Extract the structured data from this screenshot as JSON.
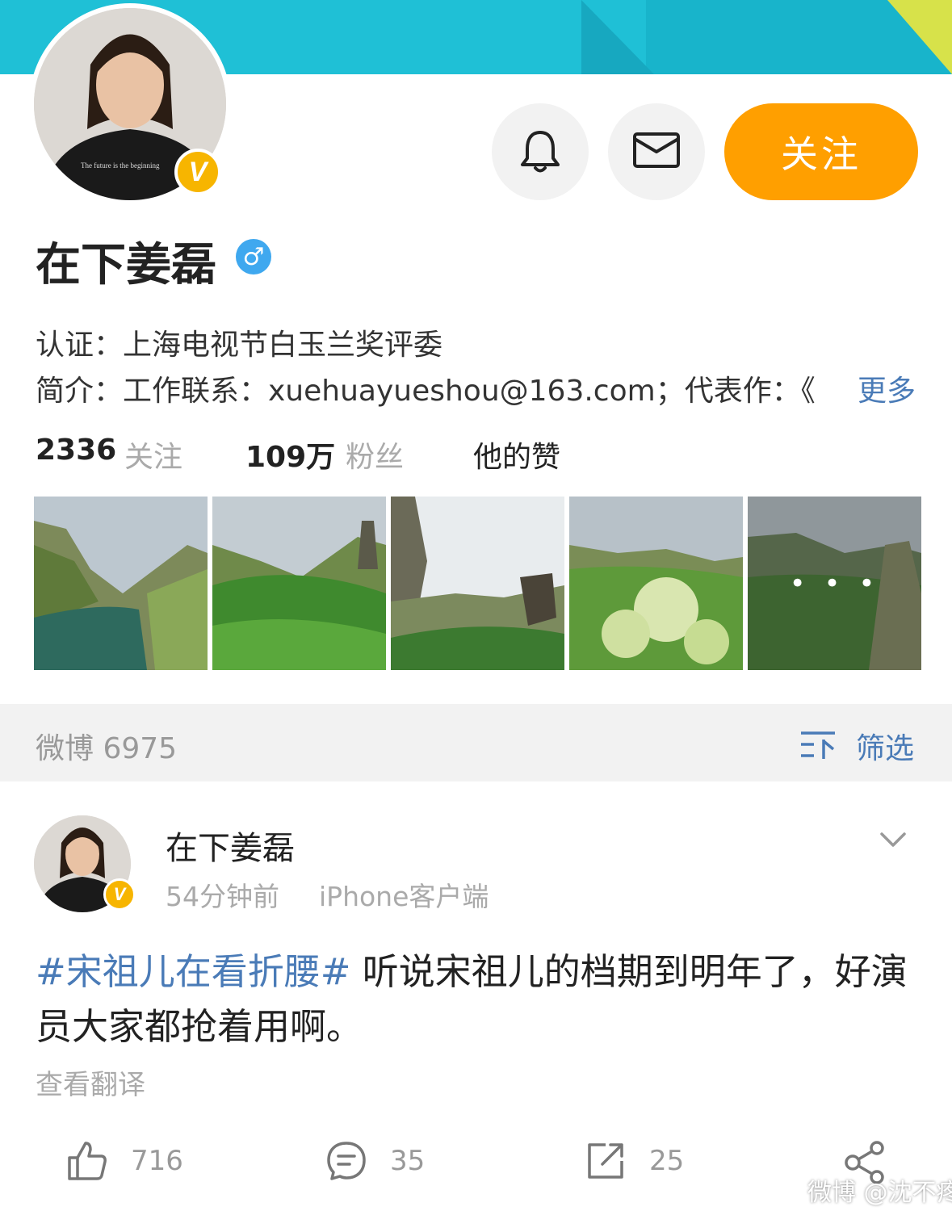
{
  "colors": {
    "accent": "#ff9f00",
    "link": "#4a7bb7",
    "banner": "#1fc0d6",
    "verified": "#f7b500",
    "gender": "#3fa8ef"
  },
  "profile": {
    "name": "在下姜磊",
    "verified_badge": "V",
    "gender_icon": "♂",
    "certification": "认证：上海电视节白玉兰奖评委",
    "bio": "简介：工作联系：xuehuayueshou@163.com；代表作：《",
    "more_label": "更多",
    "follow_label": "关注",
    "stats": {
      "following_count": "2336",
      "following_label": "关注",
      "followers_count": "109万",
      "followers_label": "粉丝",
      "likes_label": "他的赞"
    },
    "more_photos_glyph": "• • •"
  },
  "feed_header": {
    "count_label": "微博 6975",
    "filter_label": "筛选"
  },
  "post": {
    "author": "在下姜磊",
    "time": "54分钟前",
    "client": "iPhone客户端",
    "hashtag": "#宋祖儿在看折腰#",
    "text": " 听说宋祖儿的档期到明年了，好演员大家都抢着用啊。",
    "translate_label": "查看翻译",
    "likes": "716",
    "comments": "35",
    "reposts": "25"
  },
  "watermark": "微博 @沈不疼"
}
